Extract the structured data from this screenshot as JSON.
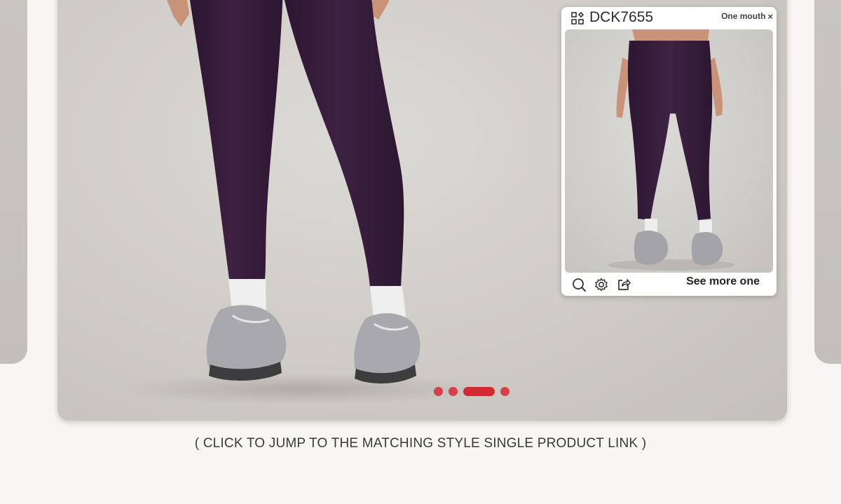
{
  "popup": {
    "code": "DCK7655",
    "close_label": "One mouth",
    "close_glyph": "×",
    "qr_icon": "qr-code-icon",
    "tools": [
      "zoom-icon",
      "settings-icon",
      "share-icon"
    ],
    "see_more_label": "See more one"
  },
  "carousel": {
    "slide_count": 4,
    "active_index": 2,
    "accent_color": "#d12a33"
  },
  "caption": "( CLICK TO JUMP TO THE MATCHING STYLE SINGLE PRODUCT LINK )",
  "colors": {
    "background": "#f7f6f4",
    "product": "#3a1d3b"
  }
}
